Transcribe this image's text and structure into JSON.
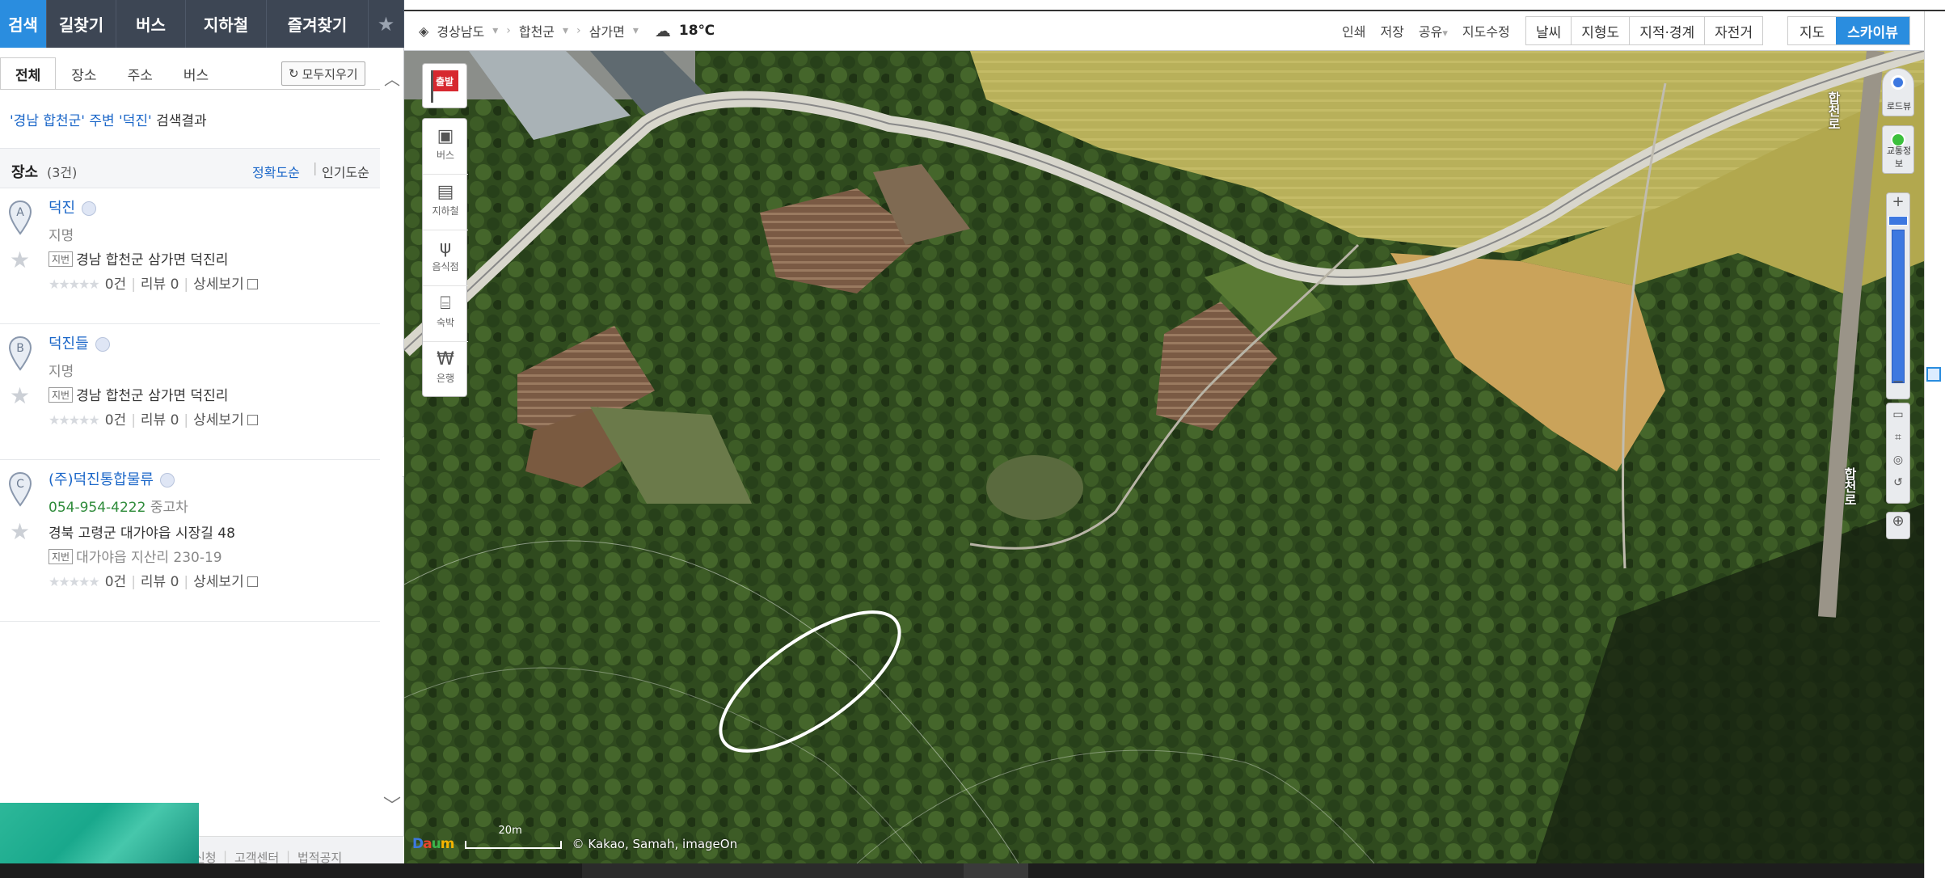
{
  "nav": {
    "tabs": [
      "검색",
      "길찾기",
      "버스",
      "지하철",
      "즐겨찾기"
    ],
    "active": "검색"
  },
  "panel": {
    "subtabs": [
      "전체",
      "장소",
      "주소",
      "버스"
    ],
    "clear_all": "모두지우기",
    "summary": {
      "pre": "'경남 합천군' 주변 ",
      "query": "'덕진'",
      "post": " 검색결과"
    },
    "list_title": "장소",
    "list_count": "(3건)",
    "sort_accuracy": "정확도순",
    "sort_popular": "인기도순",
    "results": [
      {
        "marker": "A",
        "name": "덕진",
        "category": "지명",
        "jibun_label": "지번",
        "address": "경남 합천군 삼가면 덕진리",
        "reviews": "0건",
        "review_count": "리뷰 0",
        "detail": "상세보기"
      },
      {
        "marker": "B",
        "name": "덕진들",
        "category": "지명",
        "jibun_label": "지번",
        "address": "경남 합천군 삼가면 덕진리",
        "reviews": "0건",
        "review_count": "리뷰 0",
        "detail": "상세보기"
      },
      {
        "marker": "C",
        "name": "(주)덕진통합물류",
        "phone": "054-954-4222",
        "category": "중고차",
        "road_address": "경북 고령군 대가야읍 시장길 48",
        "jibun_label": "지번",
        "address": "대가야읍 지산리 230-19",
        "reviews": "0건",
        "review_count": "리뷰 0",
        "detail": "상세보기"
      }
    ],
    "footer": [
      "신청",
      "고객센터",
      "법적공지"
    ]
  },
  "mapbar": {
    "region": [
      "경상남도",
      "합천군",
      "삼가면"
    ],
    "temperature": "18℃",
    "links": [
      "인쇄",
      "저장",
      "공유",
      "지도수정"
    ],
    "toggles": [
      "날씨",
      "지형도",
      "지적·경계",
      "자전거"
    ],
    "map_types": [
      "지도",
      "스카이뷰"
    ],
    "active_type": "스카이뷰"
  },
  "map_tools": {
    "start": "출발",
    "poi": [
      "버스",
      "지하철",
      "음식점",
      "숙박",
      "은행"
    ],
    "roadview": "로드뷰",
    "traffic": "교통정보"
  },
  "map": {
    "road_labels": [
      "합천로",
      "합천로"
    ],
    "scale": "20m",
    "logo": "Daum",
    "copyright": "© Kakao, Samah, imageOn"
  },
  "colors": {
    "accent": "#2a8ddf",
    "nav_bg": "#3d4654",
    "link": "#1a66c8"
  }
}
